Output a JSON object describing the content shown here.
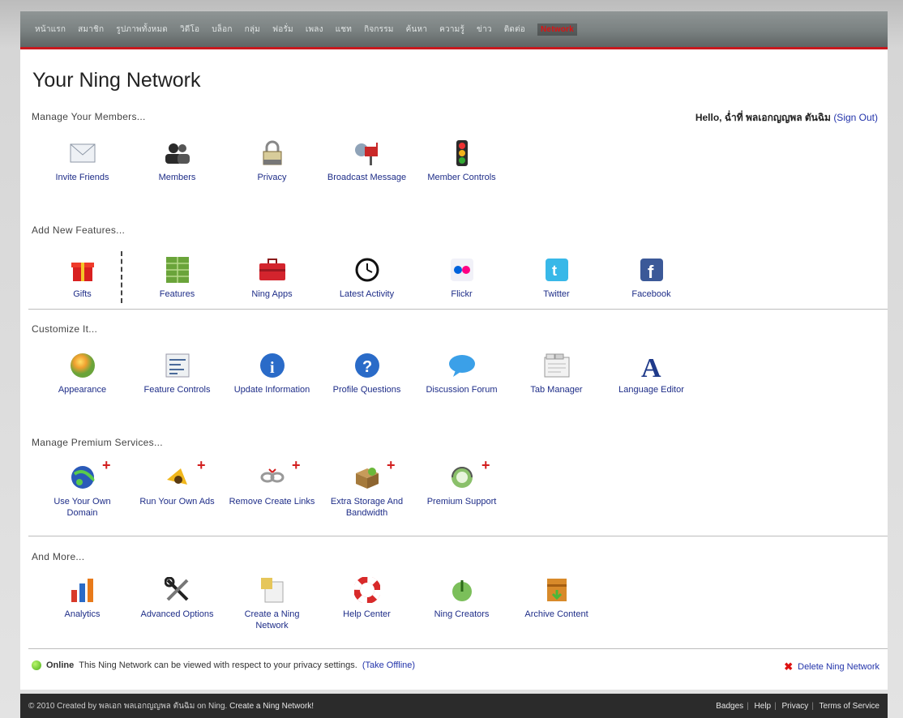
{
  "topnav": {
    "items": [
      "หน้าแรก",
      "สมาชิก",
      "รูปภาพทั้งหมด",
      "วิดีโอ",
      "บล็อก",
      "กลุ่ม",
      "ฟอรั่ม",
      "เพลง",
      "แชท",
      "กิจกรรม",
      "ค้นหา",
      "ความรู้",
      "ข่าว",
      "ติดต่อ",
      "Network"
    ],
    "brand": "Network"
  },
  "page": {
    "title": "Your Ning Network",
    "hello_prefix": "Hello,",
    "hello_name": "ฉ่ำที่ พลเอกญญพล ตันฉิม",
    "sign_out": "(Sign Out)"
  },
  "sections": {
    "manage_members": "Manage Your Members...",
    "add_features": "Add New Features...",
    "customize": "Customize It...",
    "premium": "Manage Premium Services...",
    "more": "And More..."
  },
  "members": [
    {
      "label": "Invite Friends",
      "icon": "envelope-icon"
    },
    {
      "label": "Members",
      "icon": "members-icon"
    },
    {
      "label": "Privacy",
      "icon": "lock-icon"
    },
    {
      "label": "Broadcast Message",
      "icon": "mailbox-icon"
    },
    {
      "label": "Member Controls",
      "icon": "traffic-light-icon"
    }
  ],
  "features": [
    {
      "label": "Gifts",
      "icon": "gift-icon"
    },
    {
      "label": "Features",
      "icon": "features-grid-icon"
    },
    {
      "label": "Ning Apps",
      "icon": "toolbox-icon"
    },
    {
      "label": "Latest Activity",
      "icon": "clock-icon"
    },
    {
      "label": "Flickr",
      "icon": "flickr-icon"
    },
    {
      "label": "Twitter",
      "icon": "twitter-icon"
    },
    {
      "label": "Facebook",
      "icon": "facebook-icon"
    }
  ],
  "customize": [
    {
      "label": "Appearance",
      "icon": "palette-icon"
    },
    {
      "label": "Feature Controls",
      "icon": "feature-controls-icon"
    },
    {
      "label": "Update Information",
      "icon": "info-icon"
    },
    {
      "label": "Profile Questions",
      "icon": "question-icon"
    },
    {
      "label": "Discussion Forum",
      "icon": "speech-bubble-icon"
    },
    {
      "label": "Tab Manager",
      "icon": "tab-manager-icon"
    },
    {
      "label": "Language Editor",
      "icon": "language-a-icon"
    }
  ],
  "premium": [
    {
      "label": "Use Your Own Domain",
      "icon": "globe-icon"
    },
    {
      "label": "Run Your Own Ads",
      "icon": "ads-icon"
    },
    {
      "label": "Remove Create Links",
      "icon": "remove-links-icon"
    },
    {
      "label": "Extra Storage And Bandwidth",
      "icon": "storage-box-icon"
    },
    {
      "label": "Premium Support",
      "icon": "support-icon"
    }
  ],
  "more": [
    {
      "label": "Analytics",
      "icon": "analytics-icon"
    },
    {
      "label": "Advanced Options",
      "icon": "tools-icon"
    },
    {
      "label": "Create a Ning Network",
      "icon": "create-network-icon"
    },
    {
      "label": "Help Center",
      "icon": "lifebuoy-icon"
    },
    {
      "label": "Ning Creators",
      "icon": "ning-creators-icon"
    },
    {
      "label": "Archive Content",
      "icon": "archive-icon"
    }
  ],
  "status": {
    "state": "Online",
    "text": "This Ning Network can be viewed with respect to your privacy settings.",
    "take_offline": "(Take Offline)",
    "delete": "Delete Ning Network"
  },
  "footer": {
    "left": "© 2010   Created by พลเอก พลเอกญญพล ตันฉิม on Ning.",
    "create": "Create a Ning Network!",
    "links": [
      "Badges",
      "Help",
      "Privacy",
      "Terms of Service"
    ]
  }
}
